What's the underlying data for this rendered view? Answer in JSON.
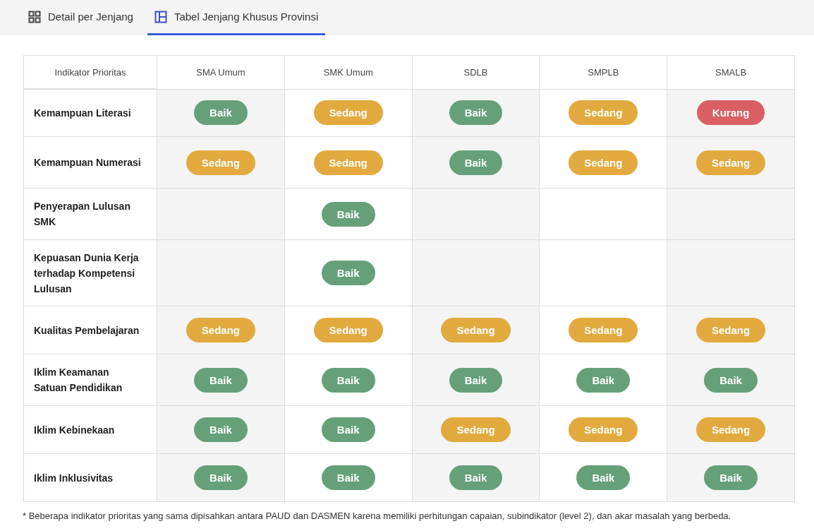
{
  "tabs": [
    {
      "label": "Detail per Jenjang",
      "kind": "grid",
      "selected": false
    },
    {
      "label": "Tabel Jenjang Khusus Provinsi",
      "kind": "layout",
      "selected": true
    }
  ],
  "table": {
    "columns": [
      "Indikator Prioritas",
      "SMA Umum",
      "SMK Umum",
      "SDLB",
      "SMPLB",
      "SMALB"
    ],
    "rows": [
      {
        "cells": [
          "Kemampuan Literasi",
          {
            "label": "Baik",
            "color": "#65a078"
          },
          {
            "label": "Sedang",
            "color": "#e2aa3e"
          },
          {
            "label": "Baik",
            "color": "#65a078"
          },
          {
            "label": "Sedang",
            "color": "#e2aa3e"
          },
          {
            "label": "Kurang",
            "color": "#d95f63"
          }
        ]
      },
      {
        "cells": [
          "Kemampuan Numerasi",
          {
            "label": "Sedang",
            "color": "#e2aa3e"
          },
          {
            "label": "Sedang",
            "color": "#e2aa3e"
          },
          {
            "label": "Baik",
            "color": "#65a078"
          },
          {
            "label": "Sedang",
            "color": "#e2aa3e"
          },
          {
            "label": "Sedang",
            "color": "#e2aa3e"
          }
        ]
      },
      {
        "cells": [
          "Penyerapan Lulusan SMK",
          "",
          {
            "label": "Baik",
            "color": "#65a078"
          },
          "",
          "",
          ""
        ]
      },
      {
        "cells": [
          "Kepuasan Dunia Kerja terhadap Kompetensi Lulusan",
          "",
          {
            "label": "Baik",
            "color": "#65a078"
          },
          "",
          "",
          ""
        ]
      },
      {
        "cells": [
          "Kualitas Pembelajaran",
          {
            "label": "Sedang",
            "color": "#e2aa3e"
          },
          {
            "label": "Sedang",
            "color": "#e2aa3e"
          },
          {
            "label": "Sedang",
            "color": "#e2aa3e"
          },
          {
            "label": "Sedang",
            "color": "#e2aa3e"
          },
          {
            "label": "Sedang",
            "color": "#e2aa3e"
          }
        ]
      },
      {
        "cells": [
          "Iklim Keamanan Satuan Pendidikan",
          {
            "label": "Baik",
            "color": "#65a078"
          },
          {
            "label": "Baik",
            "color": "#65a078"
          },
          {
            "label": "Baik",
            "color": "#65a078"
          },
          {
            "label": "Baik",
            "color": "#65a078"
          },
          {
            "label": "Baik",
            "color": "#65a078"
          }
        ]
      },
      {
        "cells": [
          "Iklim Kebinekaan",
          {
            "label": "Baik",
            "color": "#65a078"
          },
          {
            "label": "Baik",
            "color": "#65a078"
          },
          {
            "label": "Sedang",
            "color": "#e2aa3e"
          },
          {
            "label": "Sedang",
            "color": "#e2aa3e"
          },
          {
            "label": "Sedang",
            "color": "#e2aa3e"
          }
        ]
      },
      {
        "cells": [
          "Iklim Inklusivitas",
          {
            "label": "Baik",
            "color": "#65a078"
          },
          {
            "label": "Baik",
            "color": "#65a078"
          },
          {
            "label": "Baik",
            "color": "#65a078"
          },
          {
            "label": "Baik",
            "color": "#65a078"
          },
          {
            "label": "Baik",
            "color": "#65a078"
          }
        ]
      }
    ]
  },
  "footnote": "* Beberapa indikator prioritas yang sama dipisahkan antara PAUD dan DASMEN karena memiliki perhitungan capaian, subindikator (level 2), dan akar masalah yang berbeda."
}
